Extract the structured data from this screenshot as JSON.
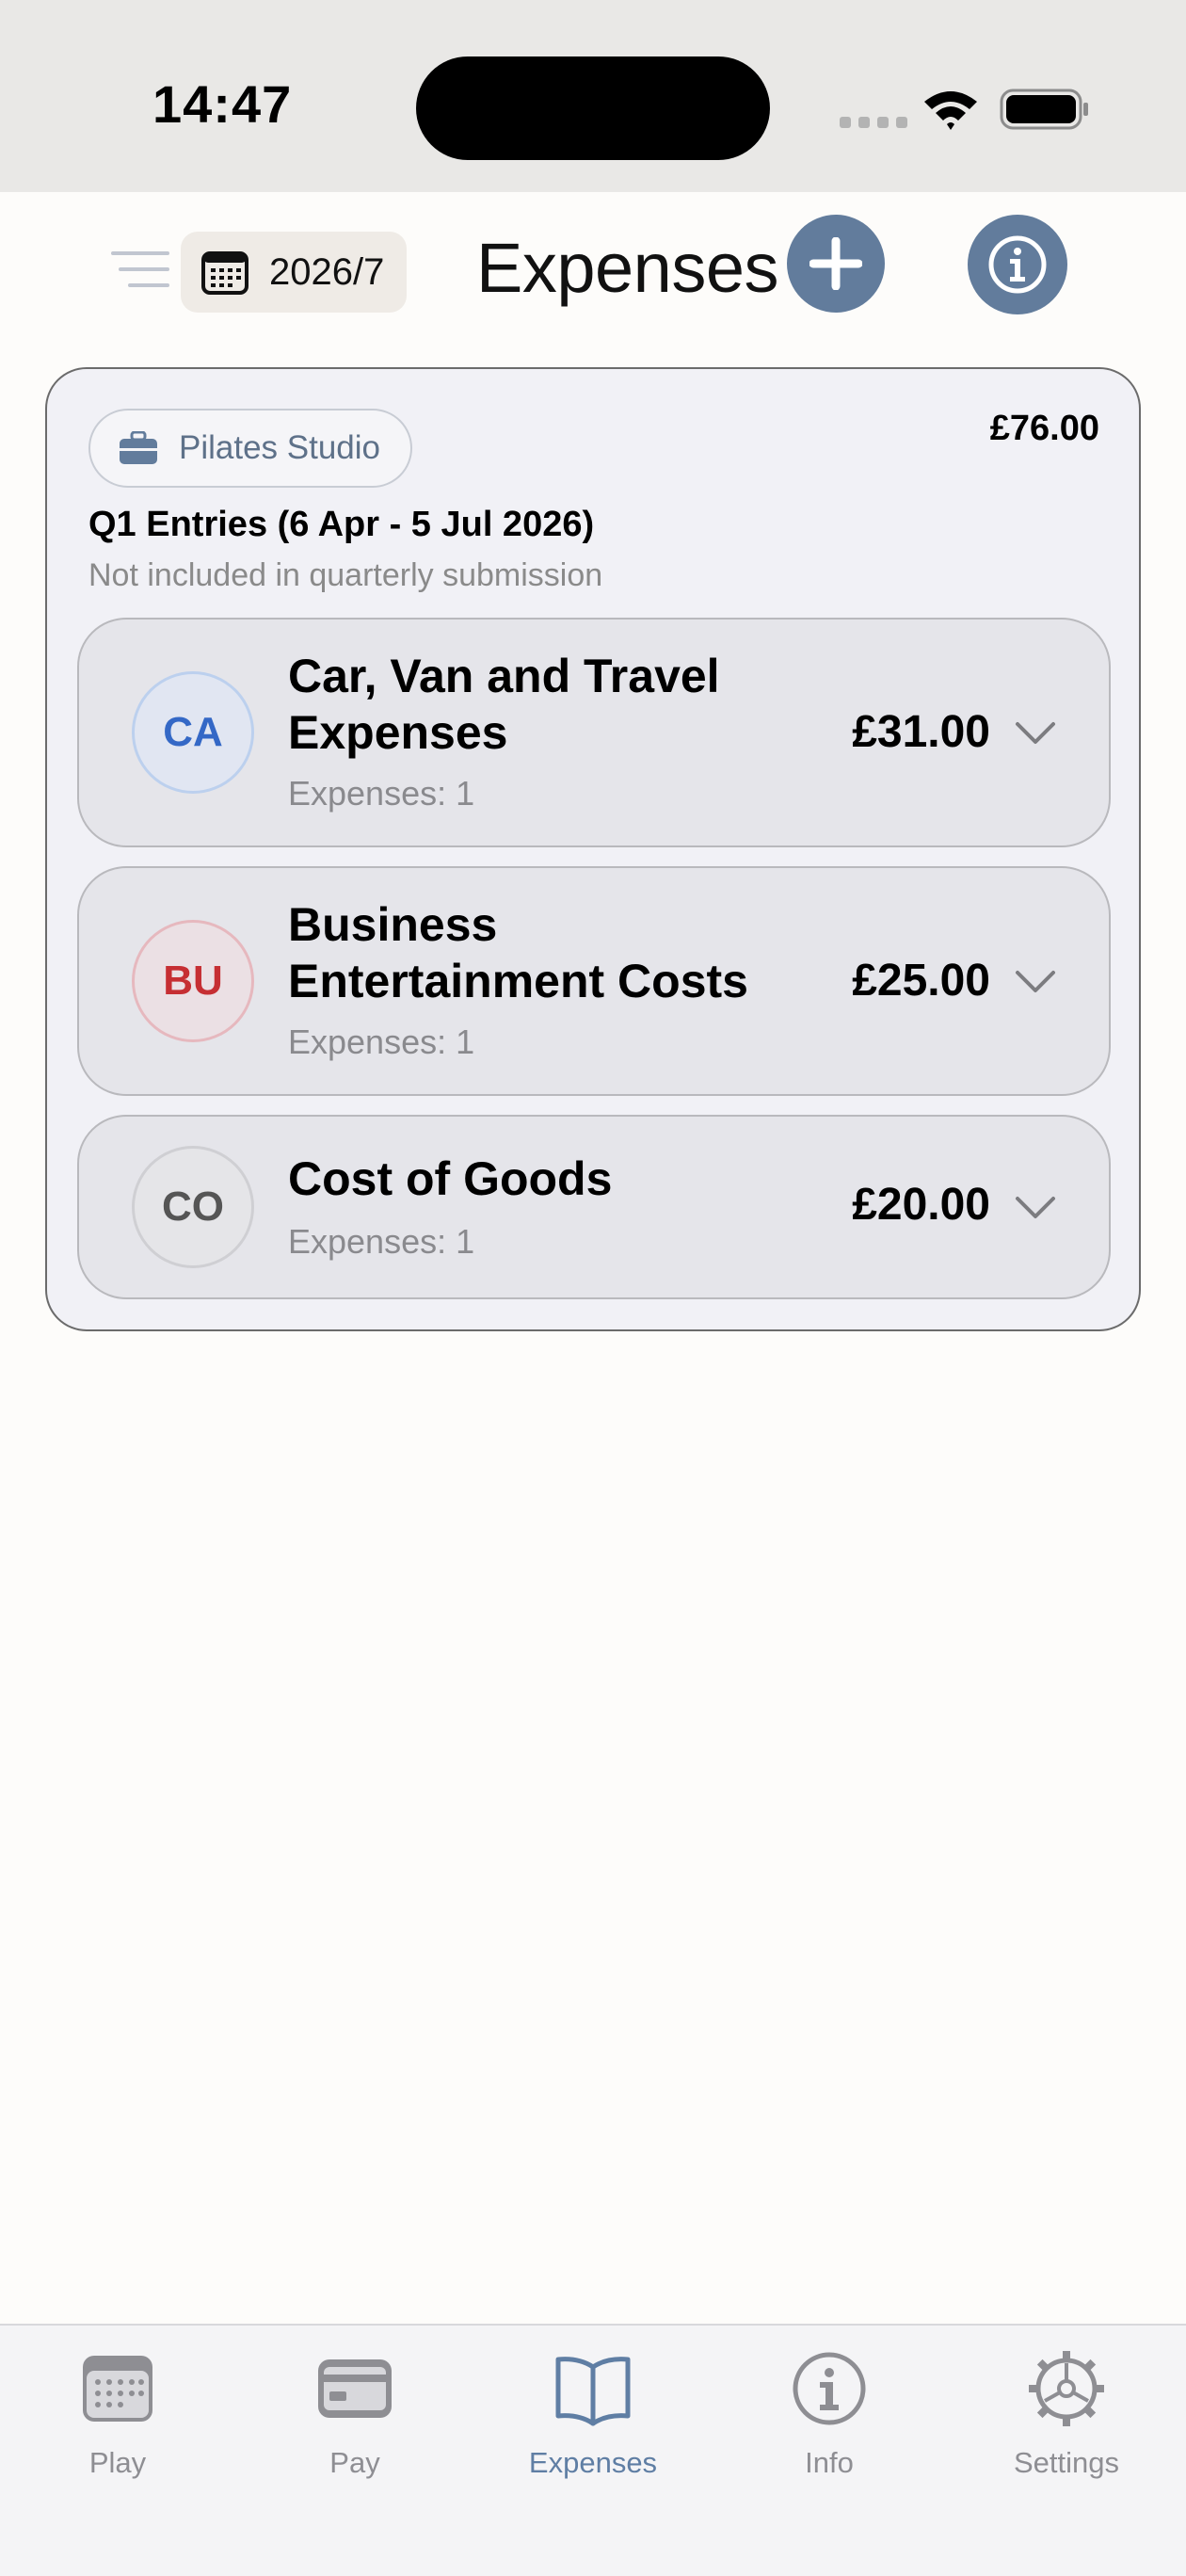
{
  "status_bar": {
    "time": "14:47"
  },
  "header": {
    "date_label": "2026/7",
    "title": "Expenses"
  },
  "business": {
    "name": "Pilates Studio",
    "total": "£76.00",
    "period_title": "Q1 Entries (6 Apr - 5 Jul 2026)",
    "period_note": "Not included in quarterly submission"
  },
  "categories": [
    {
      "badge": "CA",
      "name": "Car, Van and Travel Expenses",
      "count": "Expenses: 1",
      "amount": "£31.00"
    },
    {
      "badge": "BU",
      "name": "Business Entertainment Costs",
      "count": "Expenses: 1",
      "amount": "£25.00"
    },
    {
      "badge": "CO",
      "name": "Cost of Goods",
      "count": "Expenses: 1",
      "amount": "£20.00"
    }
  ],
  "tabs": [
    {
      "label": "Play",
      "icon": "calendar-icon"
    },
    {
      "label": "Pay",
      "icon": "credit-card-icon"
    },
    {
      "label": "Expenses",
      "icon": "book-icon",
      "active": true
    },
    {
      "label": "Info",
      "icon": "info-icon"
    },
    {
      "label": "Settings",
      "icon": "gear-icon"
    }
  ],
  "colors": {
    "accent": "#627c9c",
    "active_tab": "#5f7ea4",
    "badge_ca": "#3468c6",
    "badge_bu": "#c62f33",
    "badge_co": "#555555"
  }
}
